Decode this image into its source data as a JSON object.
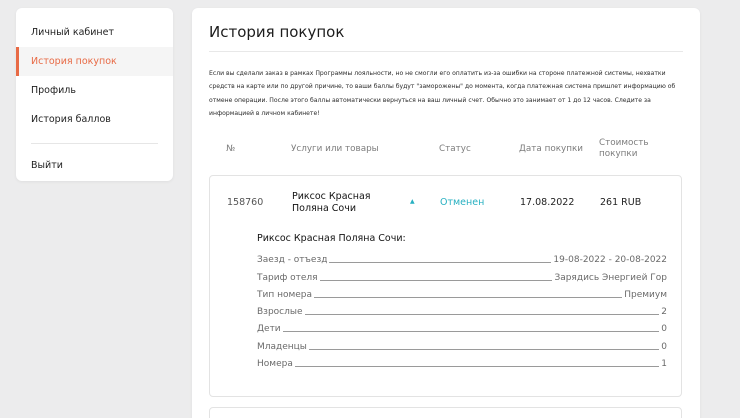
{
  "sidebar": {
    "items": [
      {
        "label": "Личный кабинет",
        "active": false
      },
      {
        "label": "История покупок",
        "active": true
      },
      {
        "label": "Профиль",
        "active": false
      },
      {
        "label": "История баллов",
        "active": false
      }
    ],
    "logout_label": "Выйти"
  },
  "main": {
    "title": "История покупок",
    "notice": "Если вы сделали заказ в рамках Программы лояльности, но не смогли его оплатить из-за ошибки на стороне платежной системы, нехватки средств на карте или по другой причине, то ваши баллы будут \"заморожены\" до момента, когда платежная система пришлет информацию об отмене операции. После этого баллы автоматически вернуться на ваш личный счет. Обычно это занимает от 1 до 12 часов. Следите за информацией в личном кабинете!",
    "columns": {
      "number": "№",
      "items": "Услуги или товары",
      "status": "Статус",
      "date": "Дата покупки",
      "price": "Стоимость покупки"
    },
    "order": {
      "number": "158760",
      "product": "Риксос Красная Поляна Сочи",
      "status": "Отменен",
      "date": "17.08.2022",
      "price": "261 RUB",
      "details_title": "Риксос Красная Поляна Сочи:",
      "details": [
        {
          "label": "Заезд - отъезд",
          "value": "19-08-2022 - 20-08-2022"
        },
        {
          "label": "Тариф отеля",
          "value": "Зарядись Энергией Гор"
        },
        {
          "label": "Тип номера",
          "value": "Премиум"
        },
        {
          "label": "Взрослые",
          "value": "2"
        },
        {
          "label": "Дети",
          "value": "0"
        },
        {
          "label": "Младенцы",
          "value": "0"
        },
        {
          "label": "Номера",
          "value": "1"
        }
      ]
    }
  },
  "colors": {
    "accent": "#e86a45",
    "status_cancelled": "#27b0c1",
    "background": "#ececed"
  },
  "icons": {
    "collapse": "chevron-up-icon"
  }
}
